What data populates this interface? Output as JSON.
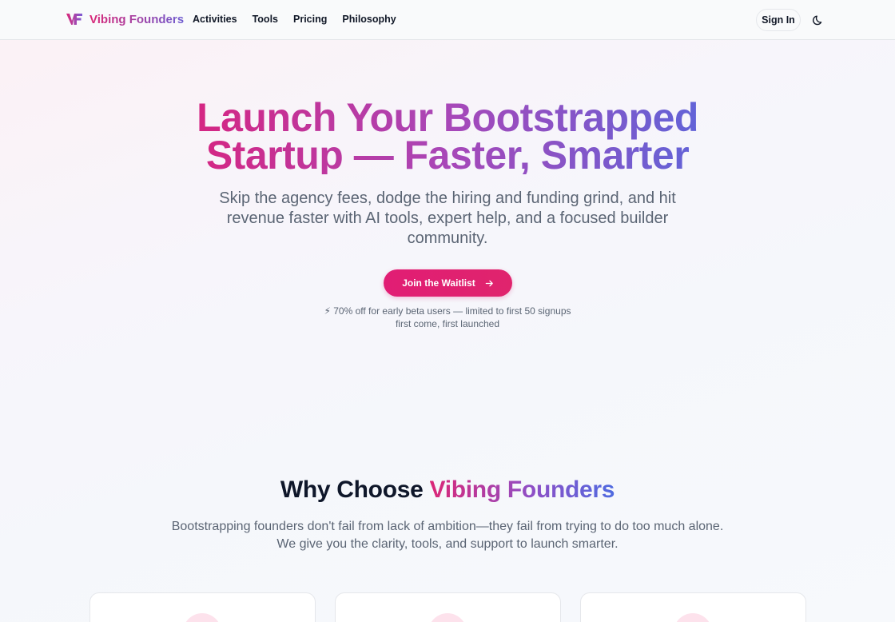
{
  "header": {
    "brand_name": "Vibing Founders",
    "nav": [
      "Activities",
      "Tools",
      "Pricing",
      "Philosophy"
    ],
    "signin_label": "Sign In",
    "theme_icon": "moon-icon"
  },
  "hero": {
    "title_line1": "Launch Your Bootstrapped",
    "title_line2": "Startup — Faster, Smarter",
    "subtitle": "Skip the agency fees, dodge the hiring and funding grind, and hit revenue faster with AI tools, expert help, and a focused builder community.",
    "cta_label": "Join the Waitlist",
    "offer_line1": "⚡ 70% off for early beta users — limited to first 50 signups",
    "offer_line2": "first come, first launched"
  },
  "why": {
    "title_prefix": "Why Choose ",
    "title_accent": "Vibing Founders",
    "subtitle": "Bootstrapping founders don't fail from lack of ambition—they fail from trying to do too much alone. We give you the clarity, tools, and support to launch smarter."
  },
  "colors": {
    "accent_pink": "#e11d74",
    "accent_purple": "#a847b8",
    "accent_blue": "#4f6be0",
    "muted_text": "#5b6574"
  }
}
